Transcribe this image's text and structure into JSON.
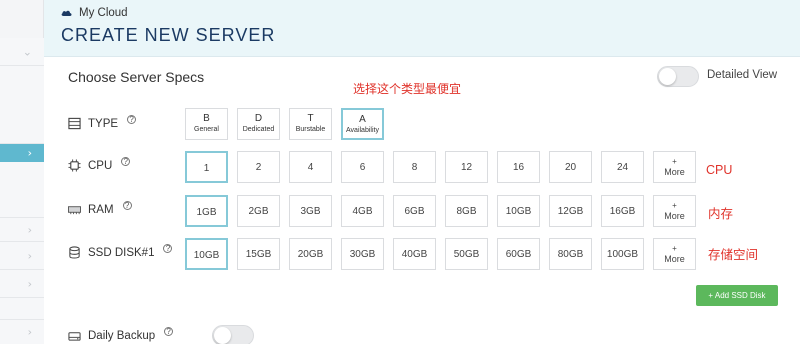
{
  "breadcrumb": {
    "label": "My Cloud",
    "icon": "cloud-icon"
  },
  "page_title": "CREATE NEW SERVER",
  "panel": {
    "title": "Choose Server Specs",
    "detailed_view_label": "Detailed View",
    "detailed_view_on": false
  },
  "annotations": {
    "type_note": "选择这个类型最便宜",
    "cpu": "CPU",
    "ram": "内存",
    "disk": "存储空间"
  },
  "type": {
    "label": "TYPE",
    "help": "?",
    "options": [
      {
        "code": "B",
        "name": "General",
        "selected": false
      },
      {
        "code": "D",
        "name": "Dedicated",
        "selected": false
      },
      {
        "code": "T",
        "name": "Burstable",
        "selected": false
      },
      {
        "code": "A",
        "name": "Availability",
        "selected": true
      }
    ]
  },
  "cpu": {
    "label": "CPU",
    "help": "?",
    "options": [
      "1",
      "2",
      "4",
      "6",
      "8",
      "12",
      "16",
      "20",
      "24"
    ],
    "selected": "1",
    "more_label": "More",
    "more_plus": "+"
  },
  "ram": {
    "label": "RAM",
    "help": "?",
    "options": [
      "1GB",
      "2GB",
      "3GB",
      "4GB",
      "6GB",
      "8GB",
      "10GB",
      "12GB",
      "16GB"
    ],
    "selected": "1GB",
    "more_label": "More",
    "more_plus": "+"
  },
  "ssd": {
    "label": "SSD DISK#1",
    "help": "?",
    "options": [
      "10GB",
      "15GB",
      "20GB",
      "30GB",
      "40GB",
      "50GB",
      "60GB",
      "80GB",
      "100GB"
    ],
    "selected": "10GB",
    "more_label": "More",
    "more_plus": "+"
  },
  "add_disk_label": "+ Add SSD Disk",
  "backup": {
    "label": "Daily Backup",
    "help": "?",
    "enabled": false
  },
  "colors": {
    "accent": "#5fb8cf",
    "title": "#1b3a63",
    "annotation": "#e0332b",
    "add_button": "#5cb85c",
    "header_bg": "#eaf6f9"
  }
}
